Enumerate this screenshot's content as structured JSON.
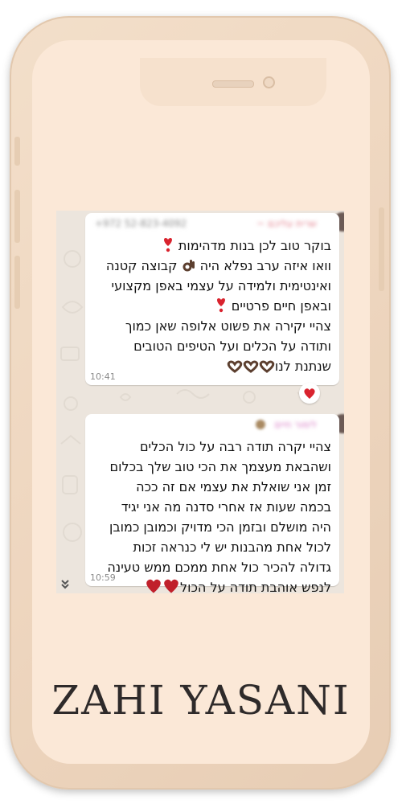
{
  "brand": {
    "name": "ZAHI YASANI"
  },
  "messages": [
    {
      "lines": [
        "בוקר טוב לכן בנות מדהימות",
        "וואו איזה ערב נפלא היה",
        "קבוצה קטנה",
        "ואינטימית ולמידה על עצמי באפן מקצועי",
        "ובאפן חיים פרטיים",
        "צהיי יקירה את פשוט אלופה שאן כמוך",
        "ותודה על הכלים ועל הטיפים הטובים",
        "שנתנת לנו"
      ],
      "time": "10:41",
      "sender_blurred": "~ שרית עליכם",
      "number_blurred": "+972 52-823-4092",
      "reaction": "heart"
    },
    {
      "lines": [
        "צהיי יקרה תודה רבה על כול הכלים",
        "ושהבאת מעצמך את הכי טוב שלך בכלום",
        "זמן אני שואלת את עצמי אם זה ככה",
        "בכמה שעות אז אחרי סדנה מה אני יגיד",
        "היה מושלם ובזמן הכי מדויק וכמובן כמובן",
        "לכול אחת מהבנות יש לי כנראה זכות",
        "גדולה להכיר כול אחת ממכם ממש טעינה",
        "לנפש אוהבת תודה על הכול"
      ],
      "time": "10:59",
      "sender_blurred": "לימור חיים"
    }
  ],
  "icons": {
    "exclamation": "red-heart-exclamation-icon",
    "ok_hand": "ok-hand-icon",
    "heart_hands": "heart-hands-icon",
    "heart": "red-heart-icon",
    "scroll": "double-chevron-down-icon"
  },
  "colors": {
    "phone_body": "#f0dac4",
    "screen": "#fbe8d7",
    "chat_bg": "#ece5dd",
    "heart": "#d9232e"
  }
}
